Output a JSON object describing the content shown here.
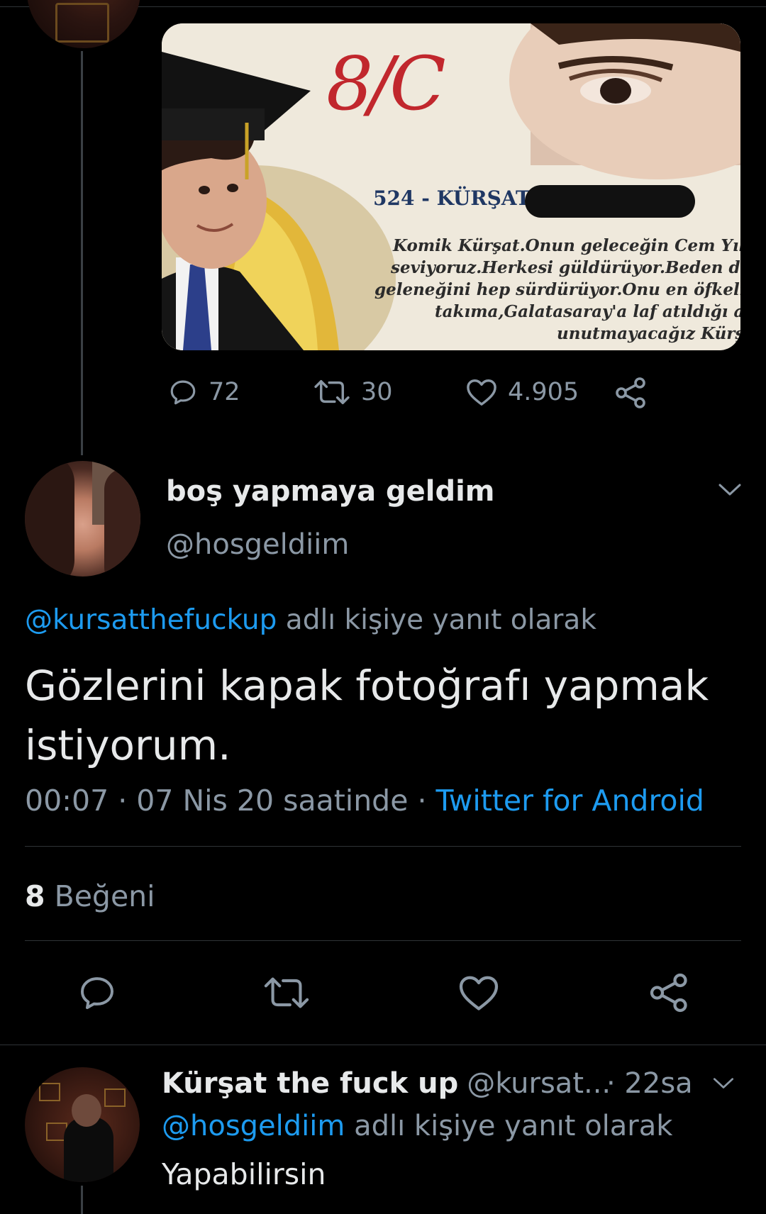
{
  "parent_tweet": {
    "media": {
      "logo": "8/C",
      "name_label": "524 - KÜRŞAT",
      "description_lines": [
        "Komik Kürşat.Onun geleceğin Cem Yılma",
        "seviyoruz.Herkesi güldürüyor.Beden ders",
        "geleneğini hep sürdürüyor.Onu en öfkeli g",
        "takıma,Galatasaray'a laf atıldığı an",
        "unutmayacağız Kürş"
      ]
    },
    "actions": {
      "replies": "72",
      "retweets": "30",
      "likes": "4.905"
    }
  },
  "focused_tweet": {
    "display_name": "boş yapmaya geldim",
    "handle": "@hosgeldiim",
    "reply_to_handle": "@kursatthefuckup",
    "reply_to_suffix": " adlı kişiye yanıt olarak",
    "text": "Gözlerini kapak fotoğrafı yapmak istiyorum.",
    "meta": {
      "time_date": "00:07 · 07 Nis 20 saatinde",
      "separator": " · ",
      "source": "Twitter for Android"
    },
    "likes_count": "8",
    "likes_label": " Beğeni"
  },
  "reply_tweet": {
    "display_name": "Kürşat the fuck up",
    "handle": "@kursat...",
    "time": "· 22sa",
    "reply_to_handle": "@hosgeldiim",
    "reply_to_suffix": " adlı kişiye yanıt olarak",
    "text": "Yapabilirsin"
  },
  "icons": [
    "reply-icon",
    "retweet-icon",
    "like-icon",
    "share-icon",
    "chevron-down-icon"
  ]
}
